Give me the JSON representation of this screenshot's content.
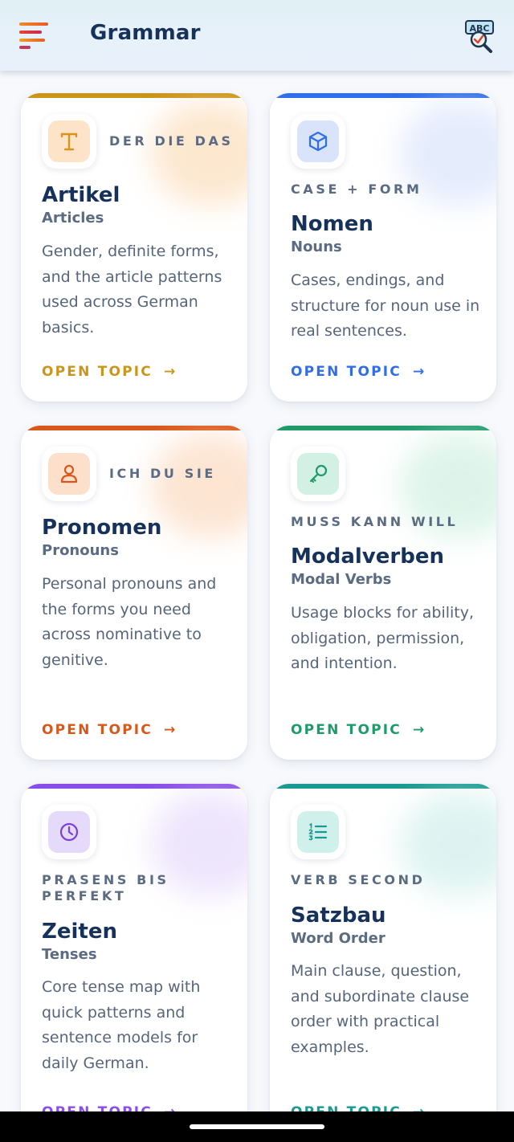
{
  "header": {
    "title": "Grammar",
    "menu_icon": "hamburger-menu-icon",
    "action_icon": "abc-search-icon",
    "action_icon_text": "ABC"
  },
  "cards": [
    {
      "tag": "DER DIE DAS",
      "title": "Artikel",
      "subtitle": "Articles",
      "description": "Gender, definite forms, and the article patterns used across German basics.",
      "cta": "OPEN TOPIC",
      "cta_arrow": "→",
      "icon": "letter-t-icon",
      "icon_text": "T",
      "accent": "#c9951a"
    },
    {
      "tag": "CASE + FORM",
      "title": "Nomen",
      "subtitle": "Nouns",
      "description": "Cases, endings, and structure for noun use in real sentences.",
      "cta": "OPEN TOPIC",
      "cta_arrow": "→",
      "icon": "cube-icon",
      "accent": "#2f6ee8"
    },
    {
      "tag": "ICH DU SIE",
      "title": "Pronomen",
      "subtitle": "Pronouns",
      "description": "Personal pronouns and the forms you need across nominative to genitive.",
      "cta": "OPEN TOPIC",
      "cta_arrow": "→",
      "icon": "person-icon",
      "accent": "#d8581a"
    },
    {
      "tag": "MUSS KANN WILL",
      "title": "Modalverben",
      "subtitle": "Modal Verbs",
      "description": "Usage blocks for ability, obligation, permission, and intention.",
      "cta": "OPEN TOPIC",
      "cta_arrow": "→",
      "icon": "key-icon",
      "accent": "#1f9a6b"
    },
    {
      "tag": "PRASENS BIS PERFEKT",
      "title": "Zeiten",
      "subtitle": "Tenses",
      "description": "Core tense map with quick patterns and sentence models for daily German.",
      "cta": "OPEN TOPIC",
      "cta_arrow": "→",
      "icon": "clock-icon",
      "accent": "#8a4ee8"
    },
    {
      "tag": "VERB SECOND",
      "title": "Satzbau",
      "subtitle": "Word Order",
      "description": "Main clause, question, and subordinate clause order with practical examples.",
      "cta": "OPEN TOPIC",
      "cta_arrow": "→",
      "icon": "numbered-list-icon",
      "accent": "#1a9a92"
    }
  ]
}
